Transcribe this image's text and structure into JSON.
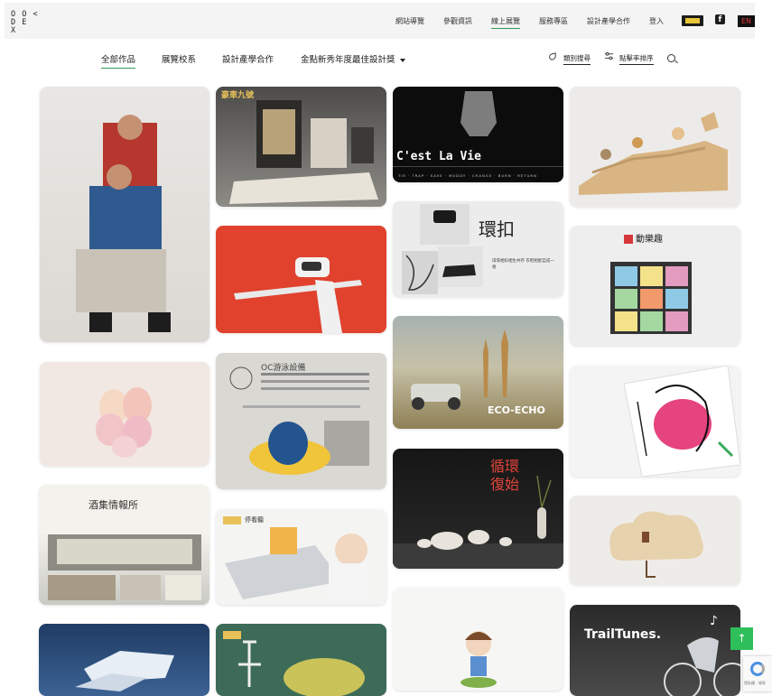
{
  "header": {
    "logo_lines": [
      "O O <",
      "D E",
      "X"
    ],
    "nav": [
      "網站導覽",
      "參觀資訊",
      "線上展覽",
      "服務專區",
      "設計產學合作",
      "登入"
    ],
    "active_nav": "線上展覽",
    "lang": "EN"
  },
  "filters": {
    "tabs": [
      "全部作品",
      "展覽校系",
      "設計產學合作",
      "金點新秀年度最佳設計獎"
    ],
    "active_tab": "全部作品",
    "category_search": "類別搜尋",
    "sort_by_clicks": "點擊率排序"
  },
  "gallery": {
    "cards": [
      {
        "title": "",
        "subtitle": ""
      },
      {
        "title": "豪車九號",
        "subtitle": ""
      },
      {
        "title": "C'est La Vie",
        "subtitle": "TIE · TRAP · SAVE · MUDDY · CHANGE · BURN · RETURN"
      },
      {
        "title": "",
        "subtitle": ""
      },
      {
        "title": "",
        "subtitle": ""
      },
      {
        "title": "環扣",
        "subtitle": "環環相扣相生共存 衣鞋相配自成一格"
      },
      {
        "title": "動樂趣",
        "subtitle": ""
      },
      {
        "title": "",
        "subtitle": ""
      },
      {
        "title": "OC游泳設備",
        "subtitle": ""
      },
      {
        "title": "ECO-ECHO",
        "subtitle": ""
      },
      {
        "title": "",
        "subtitle": ""
      },
      {
        "title": "酒集情報所",
        "subtitle": ""
      },
      {
        "title": "循環復始",
        "subtitle": ""
      },
      {
        "title": "",
        "subtitle": ""
      },
      {
        "title": "停看聽",
        "subtitle": ""
      },
      {
        "title": "",
        "subtitle": ""
      },
      {
        "title": "",
        "subtitle": ""
      },
      {
        "title": "",
        "subtitle": ""
      },
      {
        "title": "TrailTunes.",
        "subtitle": ""
      }
    ]
  },
  "ui": {
    "back_to_top": "↑",
    "recaptcha_text": "隱私權 - 條款"
  }
}
